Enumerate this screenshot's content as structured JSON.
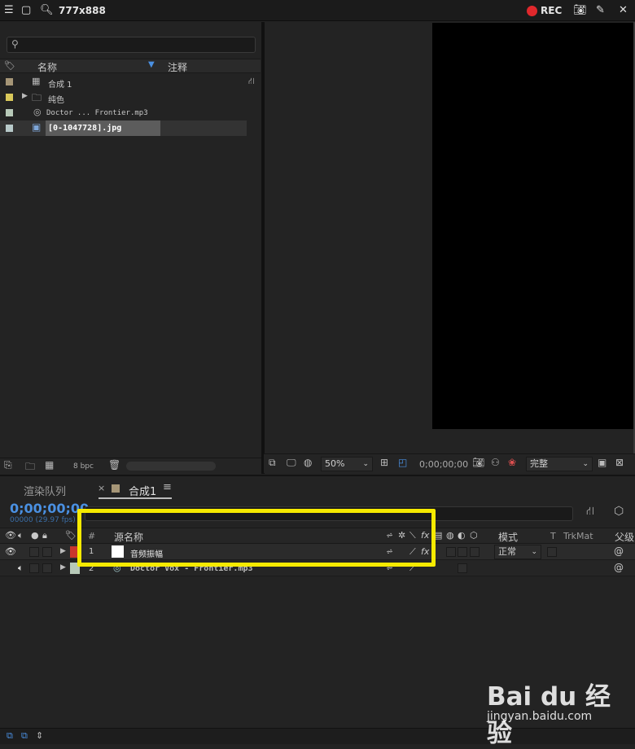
{
  "topbar": {
    "dimensions_label": "777x888",
    "rec_label": "REC"
  },
  "project": {
    "search_placeholder": "",
    "columns": {
      "name": "名称",
      "comment": "注释"
    },
    "items": [
      {
        "name": "合成 1",
        "color": "#a69677"
      },
      {
        "name": "纯色",
        "color": "#d9c85a"
      },
      {
        "name": "Doctor ... Frontier.mp3",
        "color": "#b7c9b8"
      },
      {
        "name": "[0-1047728].jpg",
        "color": "#b7c9c9"
      }
    ],
    "footer": {
      "bpc": "8 bpc"
    }
  },
  "viewer": {
    "zoom": "50%",
    "timecode": "0;00;00;00",
    "resolution": "完整"
  },
  "timeline": {
    "tabs": [
      {
        "label": "渲染队列"
      },
      {
        "label": "合成1"
      }
    ],
    "timecode": "0;00;00;00",
    "frame_info": "00000 (29.97 fps)",
    "columns": {
      "num": "#",
      "source_name": "源名称",
      "mode": "模式",
      "t": "T",
      "trkmat": "TrkMat",
      "parent": "父级"
    },
    "layers": [
      {
        "num": "1",
        "name": "音频振幅",
        "color": "#c9352c",
        "mode": "正常"
      },
      {
        "num": "2",
        "name": "Doctor Vox - Frontier.mp3",
        "color": "#b7c9b8",
        "mode": ""
      }
    ]
  },
  "watermark": {
    "logo": "Bai du 经验",
    "url": "jingyan.baidu.com"
  }
}
